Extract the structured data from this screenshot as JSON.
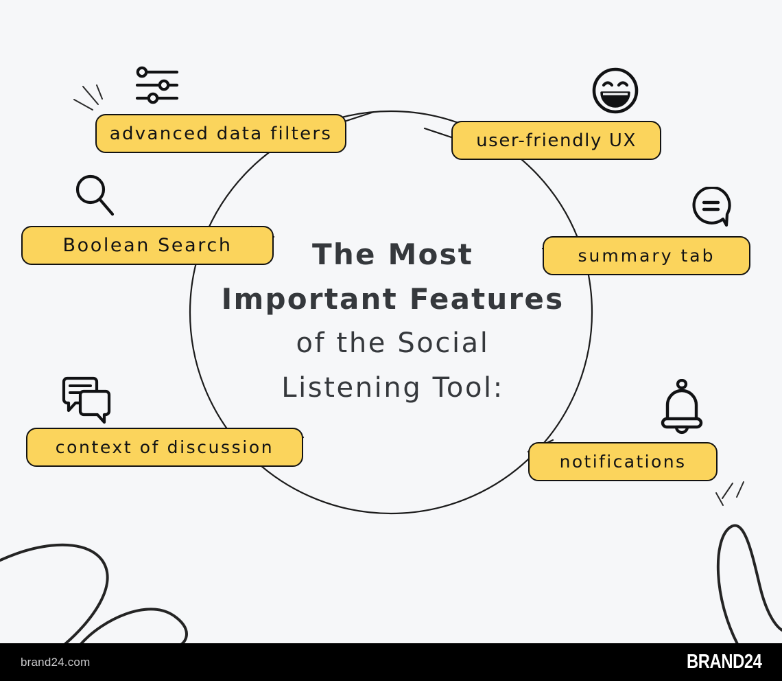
{
  "center": {
    "lines": [
      {
        "text": "The Most",
        "weight": "bold"
      },
      {
        "text": "Important Features",
        "weight": "bold"
      },
      {
        "text": "of the Social",
        "weight": "light"
      },
      {
        "text": "Listening Tool:",
        "weight": "light"
      }
    ],
    "full_title": "The Most Important Features of the Social Listening Tool:"
  },
  "features": [
    {
      "id": "advanced-data-filters",
      "label": "advanced data filters",
      "icon": "sliders-icon",
      "position": "top-left"
    },
    {
      "id": "user-friendly-ux",
      "label": "user-friendly UX",
      "icon": "smiley-face-icon",
      "position": "top-right"
    },
    {
      "id": "boolean-search",
      "label": "Boolean Search",
      "icon": "magnifier-icon",
      "position": "left"
    },
    {
      "id": "summary-tab",
      "label": "summary tab",
      "icon": "summary-bubble-icon",
      "position": "right"
    },
    {
      "id": "context-of-discussion",
      "label": "context of discussion",
      "icon": "chat-bubbles-icon",
      "position": "bottom-left"
    },
    {
      "id": "notifications",
      "label": "notifications",
      "icon": "bell-icon",
      "position": "bottom-right"
    }
  ],
  "footer": {
    "url": "brand24.com",
    "brand": "BRAND24"
  },
  "colors": {
    "background": "#f6f7f9",
    "pill_fill": "#fbd45c",
    "pill_border": "#121212",
    "title_text": "#35383c",
    "footer_bar": "#000000",
    "footer_url_text": "#c9c9cb",
    "footer_brand_text": "#ffffff",
    "line_stroke": "#1b1b1b"
  }
}
